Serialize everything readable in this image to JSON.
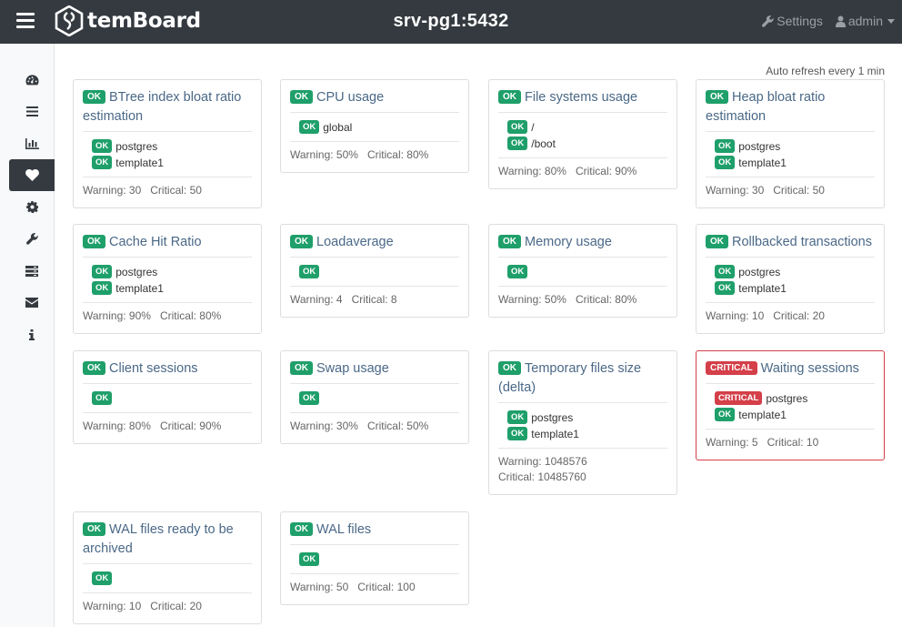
{
  "app": {
    "name": "temBoard",
    "instance": "srv-pg1:5432"
  },
  "nav": {
    "settings_label": "Settings",
    "user_label": "admin"
  },
  "sidebar": {
    "items": [
      "dashboard-icon",
      "activity-icon",
      "monitoring-icon",
      "status-icon",
      "configuration-icon",
      "maintenance-icon",
      "pg-stat-statements-icon",
      "notifications-icon",
      "about-icon"
    ],
    "active": "status-icon"
  },
  "auto_refresh": "Auto refresh every 1 min",
  "colors": {
    "topbar": "#343a40",
    "ok": "#1f9f6a",
    "critical": "#d43f49",
    "title": "#4a6887"
  },
  "cards": [
    {
      "state": "OK",
      "title": "BTree index bloat ratio estimation",
      "items": [
        {
          "state": "OK",
          "label": "postgres"
        },
        {
          "state": "OK",
          "label": "template1"
        }
      ],
      "warning": "Warning: 30",
      "critical": "Critical: 50"
    },
    {
      "state": "OK",
      "title": "CPU usage",
      "items": [
        {
          "state": "OK",
          "label": "global"
        }
      ],
      "warning": "Warning: 50%",
      "critical": "Critical: 80%"
    },
    {
      "state": "OK",
      "title": "File systems usage",
      "items": [
        {
          "state": "OK",
          "label": "/"
        },
        {
          "state": "OK",
          "label": "/boot"
        }
      ],
      "warning": "Warning: 80%",
      "critical": "Critical: 90%"
    },
    {
      "state": "OK",
      "title": "Heap bloat ratio estimation",
      "items": [
        {
          "state": "OK",
          "label": "postgres"
        },
        {
          "state": "OK",
          "label": "template1"
        }
      ],
      "warning": "Warning: 30",
      "critical": "Critical: 50"
    },
    {
      "state": "OK",
      "title": "Cache Hit Ratio",
      "items": [
        {
          "state": "OK",
          "label": "postgres"
        },
        {
          "state": "OK",
          "label": "template1"
        }
      ],
      "warning": "Warning: 90%",
      "critical": "Critical: 80%"
    },
    {
      "state": "OK",
      "title": "Loadaverage",
      "items": [
        {
          "state": "OK",
          "label": ""
        }
      ],
      "warning": "Warning: 4",
      "critical": "Critical: 8"
    },
    {
      "state": "OK",
      "title": "Memory usage",
      "items": [
        {
          "state": "OK",
          "label": ""
        }
      ],
      "warning": "Warning: 50%",
      "critical": "Critical: 80%"
    },
    {
      "state": "OK",
      "title": "Rollbacked transactions",
      "items": [
        {
          "state": "OK",
          "label": "postgres"
        },
        {
          "state": "OK",
          "label": "template1"
        }
      ],
      "warning": "Warning: 10",
      "critical": "Critical: 20"
    },
    {
      "state": "OK",
      "title": "Client sessions",
      "items": [
        {
          "state": "OK",
          "label": ""
        }
      ],
      "warning": "Warning: 80%",
      "critical": "Critical: 90%"
    },
    {
      "state": "OK",
      "title": "Swap usage",
      "items": [
        {
          "state": "OK",
          "label": ""
        }
      ],
      "warning": "Warning: 30%",
      "critical": "Critical: 50%"
    },
    {
      "state": "OK",
      "title": "Temporary files size (delta)",
      "items": [
        {
          "state": "OK",
          "label": "postgres"
        },
        {
          "state": "OK",
          "label": "template1"
        }
      ],
      "warning": "Warning: 1048576",
      "critical": "Critical: 10485760"
    },
    {
      "state": "CRITICAL",
      "title": "Waiting sessions",
      "items": [
        {
          "state": "CRITICAL",
          "label": "postgres"
        },
        {
          "state": "OK",
          "label": "template1"
        }
      ],
      "warning": "Warning: 5",
      "critical": "Critical: 10"
    },
    {
      "state": "OK",
      "title": "WAL files ready to be archived",
      "items": [
        {
          "state": "OK",
          "label": ""
        }
      ],
      "warning": "Warning: 10",
      "critical": "Critical: 20"
    },
    {
      "state": "OK",
      "title": "WAL files",
      "items": [
        {
          "state": "OK",
          "label": ""
        }
      ],
      "warning": "Warning: 50",
      "critical": "Critical: 100"
    }
  ]
}
